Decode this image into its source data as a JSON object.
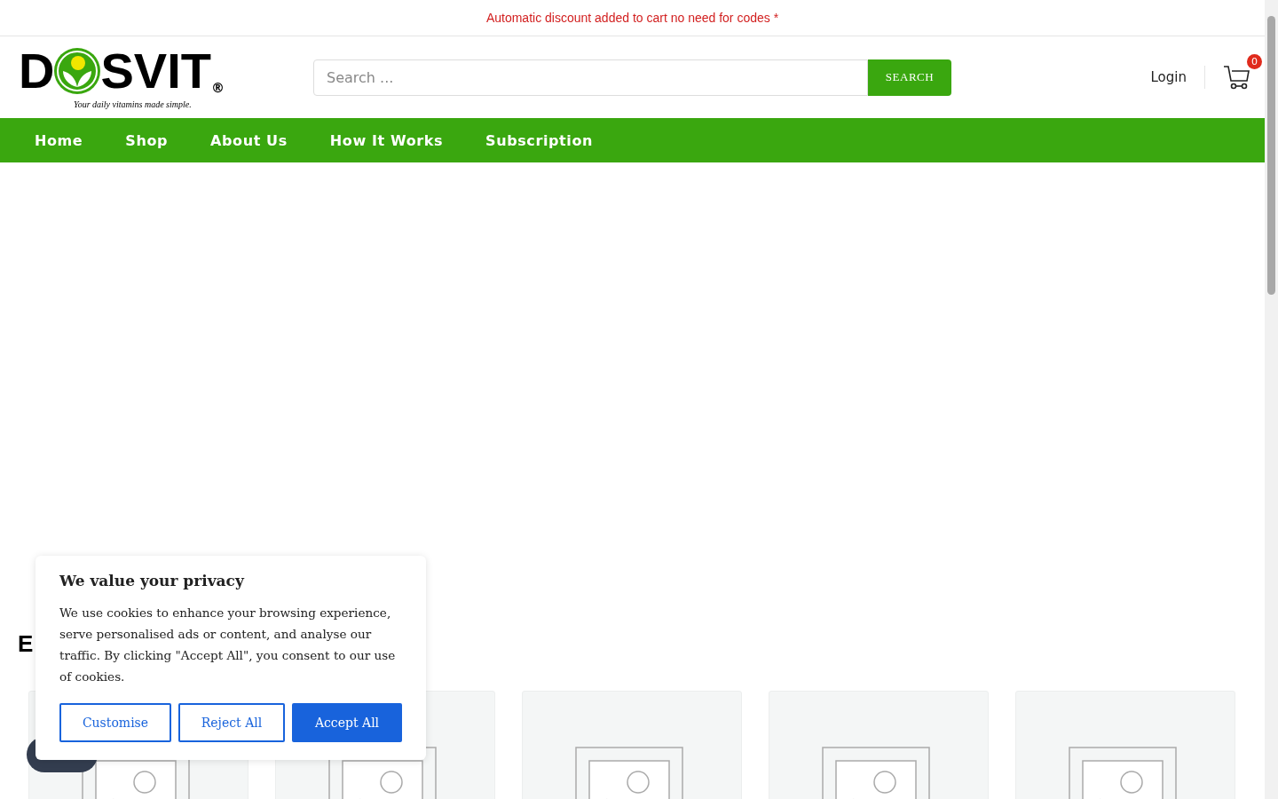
{
  "announcement": "Automatic discount added to cart no need for codes *",
  "logo": {
    "letter": "D",
    "rest": "SVIT",
    "mark": "®",
    "tagline": "Your daily vitamins made simple."
  },
  "search": {
    "placeholder": "Search ...",
    "button": "SEARCH"
  },
  "account": {
    "login": "Login",
    "cart_count": "0"
  },
  "nav": [
    {
      "label": "Home"
    },
    {
      "label": "Shop"
    },
    {
      "label": "About Us"
    },
    {
      "label": "How It Works"
    },
    {
      "label": "Subscription"
    }
  ],
  "section": {
    "heading": "E",
    "products": [
      {
        "kind": "placeholder"
      },
      {
        "kind": "placeholder"
      },
      {
        "kind": "placeholder"
      },
      {
        "kind": "placeholder"
      },
      {
        "kind": "placeholder"
      }
    ]
  },
  "cookie_banner": {
    "title": "We value your privacy",
    "text": "We use cookies to enhance your browsing experience, serve personalised ads or content, and analyse our traffic. By clicking \"Accept All\", you consent to our use of cookies.",
    "buttons": [
      {
        "label": "Customise",
        "kind": "outline"
      },
      {
        "label": "Reject All",
        "kind": "outline"
      },
      {
        "label": "Accept All",
        "kind": "primary"
      }
    ]
  }
}
